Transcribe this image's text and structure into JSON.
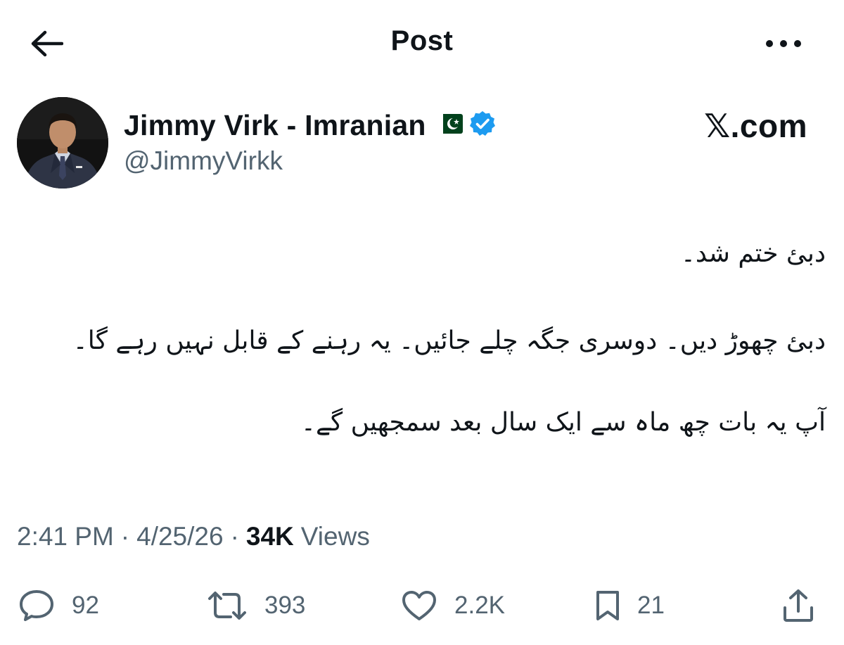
{
  "header": {
    "title": "Post",
    "back_icon": "arrow-left-icon",
    "more_icon": "more-horizontal-icon"
  },
  "author": {
    "name": "Jimmy Virk - Imranian",
    "handle": "@JimmyVirkk",
    "flag_icon": "pakistan-flag-icon",
    "verified_icon": "verified-badge-icon",
    "verified_color": "#1d9bf0"
  },
  "brand": {
    "logo_text": "𝕏.com"
  },
  "tweet": {
    "lines": [
      "دبئ ختم شد۔",
      "دبئ چھوڑ دیں۔ دوسری جگہ چلے جائیں۔ یہ رہنے کے قابل نہیں رہے گا۔",
      "آپ یہ بات چھ ماہ سے ایک سال بعد سمجھیں گے۔"
    ]
  },
  "meta": {
    "time": "2:41 PM",
    "date": "4/25/26",
    "views_count": "34K",
    "views_label": "Views",
    "separator": "·"
  },
  "actions": {
    "reply_count": "92",
    "repost_count": "393",
    "like_count": "2.2K",
    "bookmark_count": "21"
  },
  "colors": {
    "text_primary": "#0f1419",
    "text_secondary": "#536471",
    "accent": "#1d9bf0",
    "flag_green": "#01411c"
  }
}
